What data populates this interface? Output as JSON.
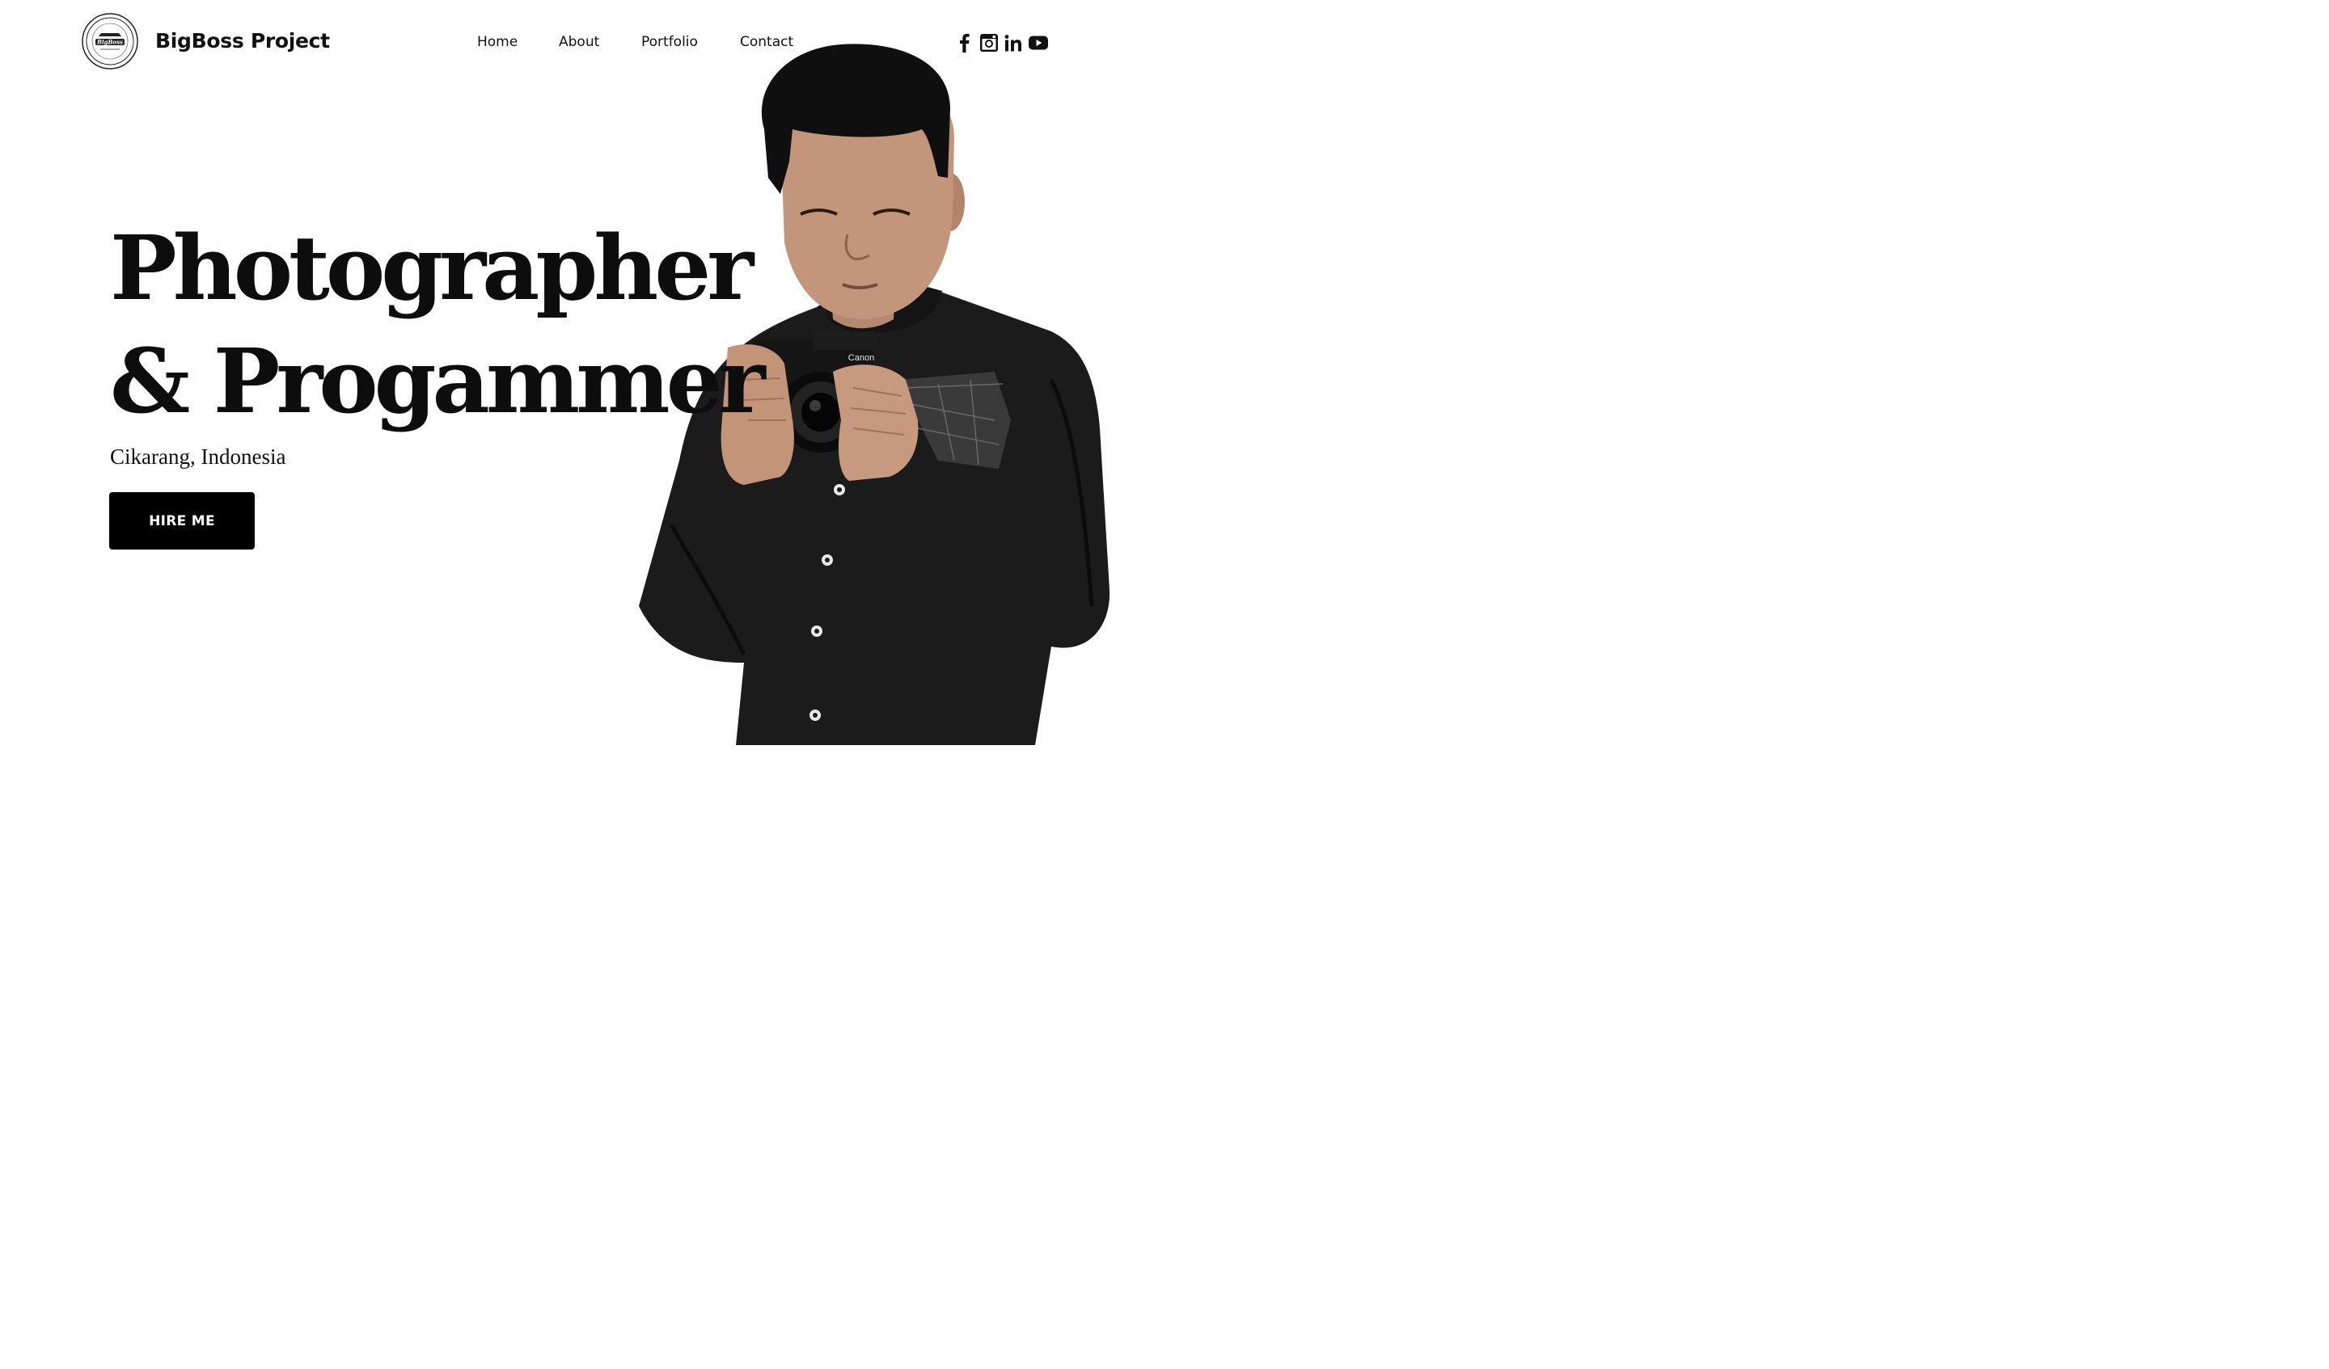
{
  "brand": {
    "logo_text_top": "SINCE 2020",
    "logo_text_mid": "BigBoss",
    "logo_text_bottom": "PHOTOGRAPHY",
    "name": "BigBoss Project"
  },
  "nav": {
    "items": [
      {
        "label": "Home"
      },
      {
        "label": "About"
      },
      {
        "label": "Portfolio"
      },
      {
        "label": "Contact"
      }
    ]
  },
  "social": {
    "icons": [
      "facebook-icon",
      "instagram-icon",
      "linkedin-icon",
      "youtube-icon"
    ]
  },
  "hero": {
    "title_line1": "Photographer",
    "title_line2": "& Progammer",
    "location": "Cikarang, Indonesia",
    "cta_label": "HIRE ME"
  },
  "colors": {
    "background": "#ffffff",
    "text": "#111111",
    "button_bg": "#000000",
    "button_text": "#ffffff",
    "shirt": "#1a1a1a"
  }
}
